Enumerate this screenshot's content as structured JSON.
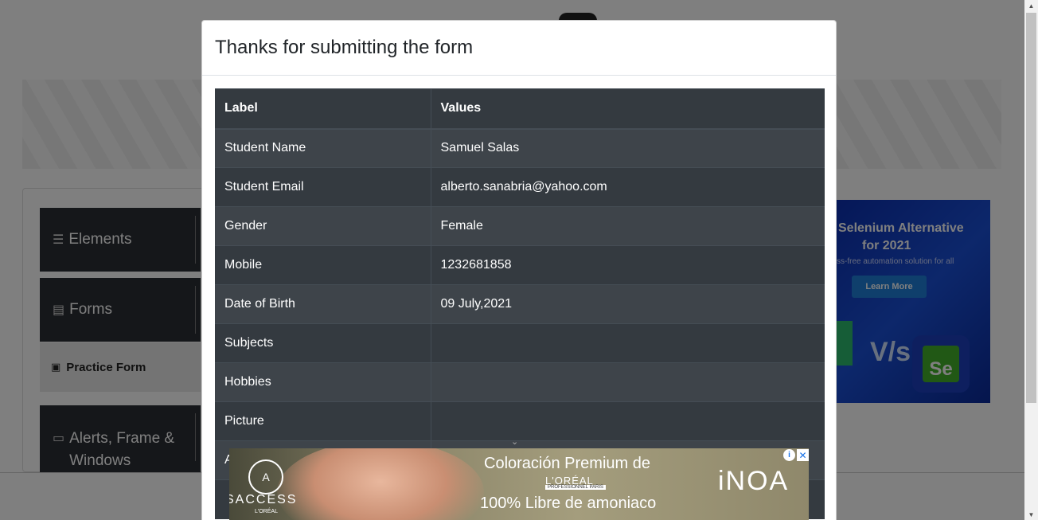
{
  "sidebar": {
    "items": [
      {
        "label": "Elements",
        "icon": "menu-icon"
      },
      {
        "label": "Forms",
        "icon": "document-icon"
      },
      {
        "label": "Alerts, Frame & Windows",
        "icon": "window-icon"
      }
    ],
    "active_sub_item": {
      "label": "Practice Form",
      "icon": "form-icon"
    }
  },
  "side_ad": {
    "line1": "Selenium Alternative",
    "line2": "for 2021",
    "line3": "ss-free automation solution for all",
    "button": "Learn More",
    "vs": "V/s",
    "logo": "Se"
  },
  "modal": {
    "title": "Thanks for submitting the form",
    "table": {
      "headers": [
        "Label",
        "Values"
      ],
      "rows": [
        [
          "Student Name",
          "Samuel Salas"
        ],
        [
          "Student Email",
          "alberto.sanabria@yahoo.com"
        ],
        [
          "Gender",
          "Female"
        ],
        [
          "Mobile",
          "1232681858"
        ],
        [
          "Date of Birth",
          "09 July,2021"
        ],
        [
          "Subjects",
          ""
        ],
        [
          "Hobbies",
          ""
        ],
        [
          "Picture",
          ""
        ]
      ],
      "partial_row_start": "A"
    }
  },
  "bottom_ad": {
    "brand": "SACCESS",
    "brand_sub": "L'ORÉAL",
    "headline1": "Coloración Premium de",
    "loreal": "L'ORÉAL",
    "professionnel": "PROFESSIONNEL PARIS",
    "headline2": "100% Libre de amoniaco",
    "product": "iNOA",
    "info": "i",
    "close": "✕"
  },
  "colors": {
    "table_bg": "#343a40",
    "table_alt": "#3e444a",
    "sidebar_bg": "#2b2f35",
    "ad_blue": "#1a4fd6"
  }
}
